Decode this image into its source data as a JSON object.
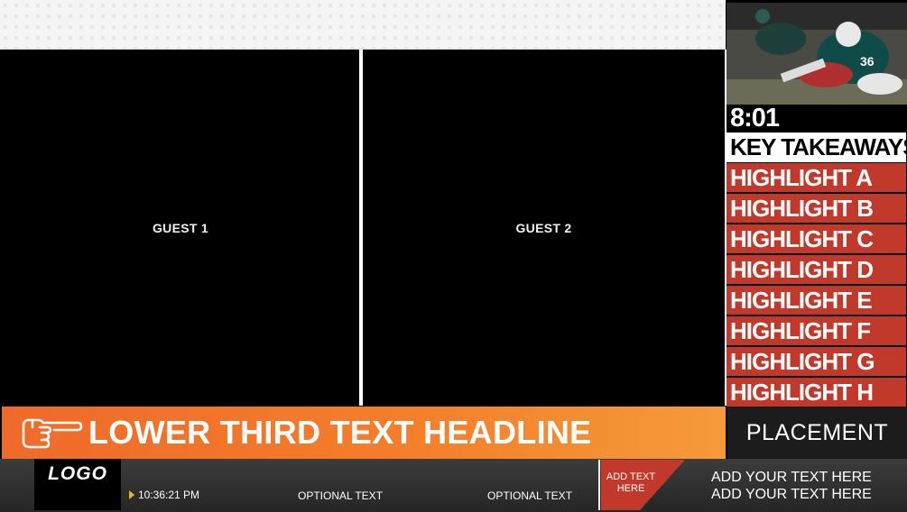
{
  "guests": {
    "guest1_label": "GUEST 1",
    "guest2_label": "GUEST 2"
  },
  "sidebar": {
    "timer": "8:01",
    "heading": "KEY TAKEAWAYS",
    "highlights": [
      "HIGHLIGHT A",
      "HIGHLIGHT B",
      "HIGHLIGHT C",
      "HIGHLIGHT D",
      "HIGHLIGHT E",
      "HIGHLIGHT F",
      "HIGHLIGHT G",
      "HIGHLIGHT H"
    ],
    "highlight_color": "#c0392b"
  },
  "lower_third": {
    "headline": "LOWER THIRD TEXT HEADLINE",
    "icon": "pointing-hand-icon",
    "gradient_start": "#ef6a2a",
    "placement_label": "PLACEMENT"
  },
  "ticker": {
    "logo": "LOGO",
    "time": "10:36:21 PM",
    "optional_1": "OPTIONAL TEXT",
    "optional_2": "OPTIONAL TEXT",
    "badge_text": "ADD TEXT HERE",
    "badge_color": "#c0392b",
    "line_1": "ADD YOUR TEXT HERE",
    "line_2": "ADD YOUR TEXT HERE"
  }
}
